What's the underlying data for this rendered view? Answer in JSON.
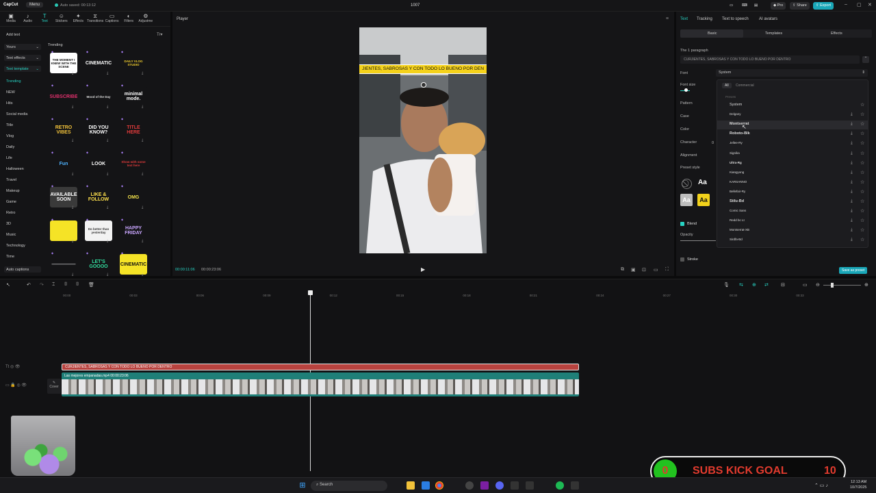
{
  "app": {
    "logo": "CapCut",
    "menu": "Menu",
    "autosave": "Auto saved: 00:13:12",
    "project_title": "1007",
    "pro": "Pro",
    "share": "Share",
    "export": "Export"
  },
  "toolbar": [
    "Media",
    "Audio",
    "Text",
    "Stickers",
    "Effects",
    "Transitions",
    "Captions",
    "Filters",
    "Adjustme"
  ],
  "toolbar_icons": [
    "media-icon",
    "audio-icon",
    "text-icon",
    "stickers-icon",
    "effects-icon",
    "transitions-icon",
    "captions-icon",
    "filters-icon",
    "adjust-icon"
  ],
  "categories": {
    "add_text": "Add text",
    "yours": "Yours",
    "text_effects": "Text effects",
    "text_template": "Text template",
    "items": [
      "Trending",
      "NEW",
      "Hits",
      "Social media",
      "Title",
      "Vlog",
      "Daily",
      "Life",
      "Halloween",
      "Travel",
      "Makeup",
      "Game",
      "Retro",
      "3D",
      "Music",
      "Technology",
      "Time"
    ],
    "auto_captions": "Auto captions"
  },
  "trending_label": "Trending",
  "templates": [
    {
      "text": "THE MOMENT I KNEW WITH THE SCENE",
      "bg": "#ffffff",
      "fg": "#111111"
    },
    {
      "text": "CINEMATIC",
      "bg": "#141416",
      "fg": "#ffffff"
    },
    {
      "text": "DAILY VLOG STUDIO",
      "bg": "#141416",
      "fg": "#f3cf2e"
    },
    {
      "text": "SUBSCRIBE",
      "bg": "#141416",
      "fg": "#e0306c"
    },
    {
      "text": "Mood of the Day",
      "bg": "#141416",
      "fg": "#dddddd"
    },
    {
      "text": "minimal mode.",
      "bg": "#141416",
      "fg": "#ffffff"
    },
    {
      "text": "RETRO VIBES",
      "bg": "#141416",
      "fg": "#f2c23a"
    },
    {
      "text": "DID YOU KNOW?",
      "bg": "#141416",
      "fg": "#ffffff"
    },
    {
      "text": "TITLE HERE",
      "bg": "#141416",
      "fg": "#e23b3b"
    },
    {
      "text": "Fun",
      "bg": "#141416",
      "fg": "#4fb3ff"
    },
    {
      "text": "LOOK",
      "bg": "#141416",
      "fg": "#ffffff"
    },
    {
      "text": "Show with some text here",
      "bg": "#141416",
      "fg": "#e23b3b"
    },
    {
      "text": "AVAILABLE SOON",
      "bg": "#3a3a3a",
      "fg": "#ffffff"
    },
    {
      "text": "LIKE & FOLLOW",
      "bg": "#141416",
      "fg": "#ffe14d"
    },
    {
      "text": "OMG",
      "bg": "#141416",
      "fg": "#f2e14a"
    },
    {
      "text": "",
      "bg": "#f5e326",
      "fg": "#111111"
    },
    {
      "text": "Do better than yesterday",
      "bg": "#f2f2f2",
      "fg": "#333333"
    },
    {
      "text": "HAPPY FRIDAY",
      "bg": "#141416",
      "fg": "#c9a6ff"
    },
    {
      "text": "—————",
      "bg": "#141416",
      "fg": "#cccccc"
    },
    {
      "text": "LET'S GOOOO",
      "bg": "#141416",
      "fg": "#33e0a0"
    },
    {
      "text": "CINEMATIC",
      "bg": "#f5e326",
      "fg": "#111111"
    }
  ],
  "player": {
    "title": "Player",
    "caption": "JIENTES, SABROSAS Y CON TODO LO BUENO POR DEN",
    "time_current": "00:00:11:06",
    "time_total": "00:00:23:06"
  },
  "right": {
    "tabs": [
      "Text",
      "Tracking",
      "Text to speech",
      "AI avatars"
    ],
    "subtabs": [
      "Basic",
      "Templates",
      "Effects"
    ],
    "paragraph_label": "The 1 paragraph",
    "paragraph_text": "CURJIENTES, SABROSAS Y CON TODO LO BUENO POR DENTRO",
    "labels": [
      "Font",
      "Font size",
      "Pattern",
      "Case",
      "Color",
      "Character",
      "Alignment",
      "Preset style"
    ],
    "font_value": "System",
    "char_value": "0",
    "filter_all": "All",
    "filter_commercial": "Commercial",
    "presets_label": "Presets",
    "fonts": [
      "System",
      "Delgany",
      "Montserrat",
      "Roboto-Blk",
      "Jellee-Ry",
      "Signika",
      "Ultra-Rg",
      "Kiangyong",
      "KARSANNO",
      "Bellefair-Ry",
      "Stilu-Bd",
      "Comic Sans",
      "Redd bc Lt",
      "Montserrat-XB",
      "Sirdfa-Bd"
    ],
    "blend": "Blend",
    "opacity": "Opacity",
    "stroke": "Stroke",
    "save_preset": "Save as preset",
    "preset_aa": "Aa"
  },
  "timeline": {
    "ticks": [
      "00:00",
      "00:03",
      "00:06",
      "00:09",
      "00:12",
      "00:15",
      "00:18",
      "00:21",
      "00:24",
      "00:27",
      "00:30",
      "00:33"
    ],
    "text_clip": "CURJIENTES, SABROSAS Y CON TODO LO BUENO POR DENTRO",
    "video_clip": "Las mejores empanadas.mp4  00:00:23:06",
    "cover": "Cover"
  },
  "overlay": {
    "goal_count": "0",
    "goal_text": "SUBS KICK GOAL",
    "goal_target": "10"
  },
  "taskbar": {
    "search": "Search",
    "time": "12:13 AM",
    "date": "10/7/2025"
  },
  "colors": {
    "accent": "#27d3c3",
    "text_clip": "#b8423e",
    "video_clip": "#1f7f78",
    "caption_bg": "#f5d21b",
    "goal_green": "#22c21f",
    "goal_red": "#e23b2e"
  }
}
